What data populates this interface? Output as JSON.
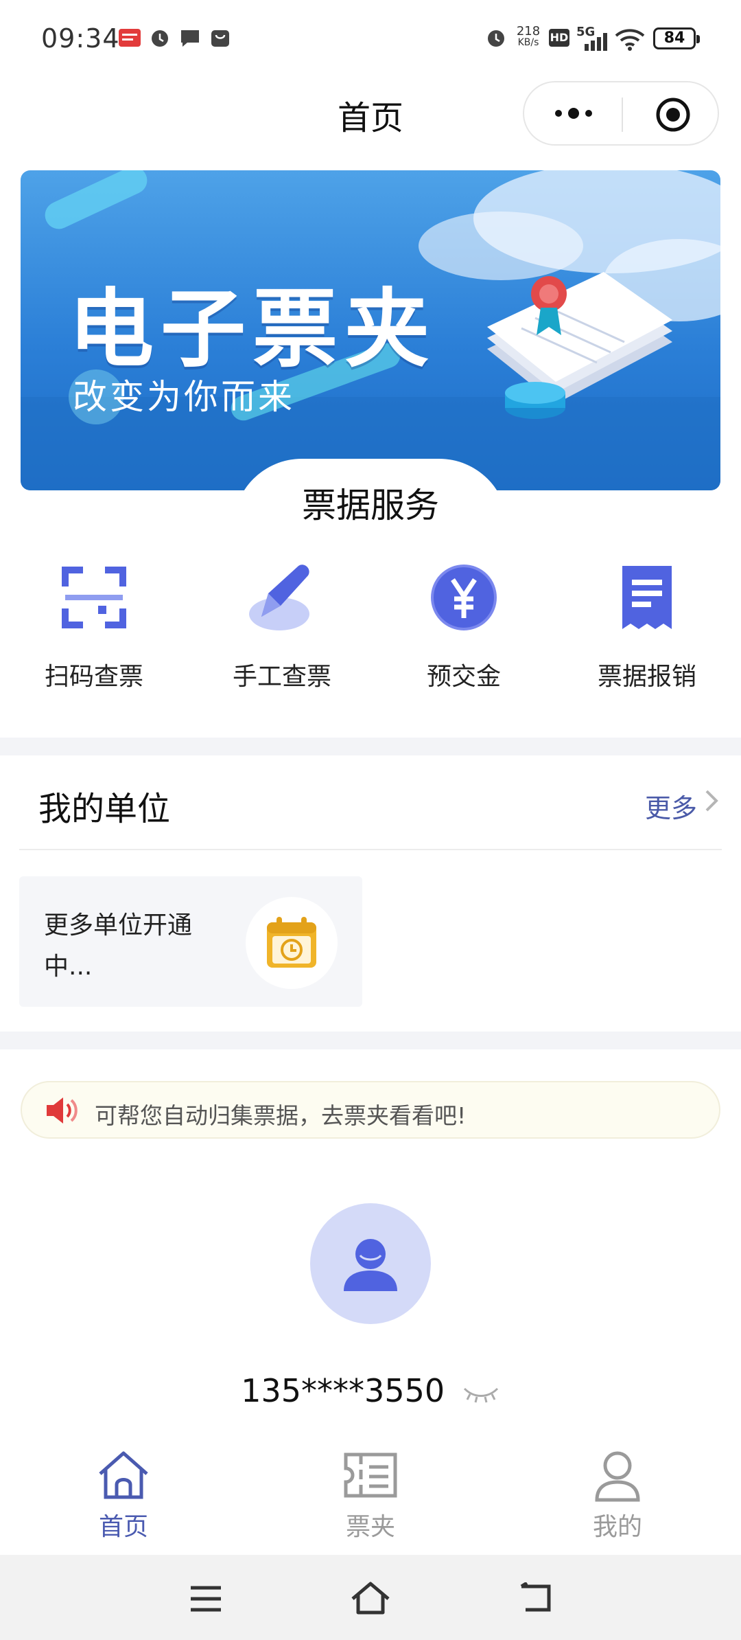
{
  "status_bar": {
    "time": "09:34",
    "net_speed_value": "218",
    "net_speed_unit": "KB/s",
    "hd": "HD",
    "signal": "5G",
    "battery": "84"
  },
  "nav": {
    "title": "首页"
  },
  "banner": {
    "title": "电子票夹",
    "subtitle": "改变为你而来"
  },
  "service_section": {
    "title": "票据服务",
    "items": [
      {
        "label": "扫码查票",
        "icon": "scan-icon"
      },
      {
        "label": "手工查票",
        "icon": "pen-icon"
      },
      {
        "label": "预交金",
        "icon": "yen-coin-icon"
      },
      {
        "label": "票据报销",
        "icon": "receipt-icon"
      }
    ]
  },
  "my_units": {
    "title": "我的单位",
    "more": "更多",
    "card_text": "更多单位开通中..."
  },
  "notice": {
    "text": "可帮您自动归集票据，去票夹看看吧!"
  },
  "user": {
    "phone": "135****3550"
  },
  "tabbar": {
    "items": [
      {
        "label": "首页",
        "active": true
      },
      {
        "label": "票夹",
        "active": false
      },
      {
        "label": "我的",
        "active": false
      }
    ]
  },
  "colors": {
    "primary": "#4a5ab0",
    "icon_blue": "#5063e0",
    "banner_blue": "#2b7fd7",
    "calendar_yellow": "#f0b429",
    "speaker_red": "#e03a3a"
  }
}
